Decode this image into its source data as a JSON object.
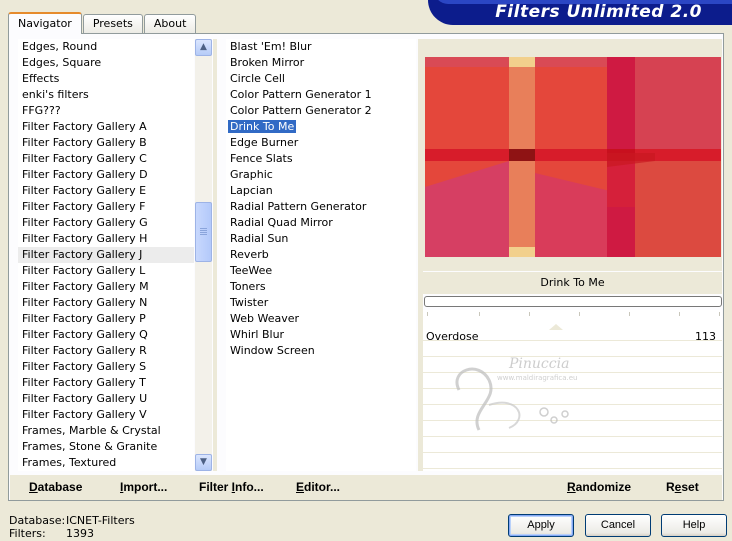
{
  "tabs": [
    "Navigator",
    "Presets",
    "About"
  ],
  "banner_title": "Filters Unlimited 2.0",
  "categories": [
    "Edges, Round",
    "Edges, Square",
    "Effects",
    "enki's filters",
    "FFG???",
    "Filter Factory Gallery A",
    "Filter Factory Gallery B",
    "Filter Factory Gallery C",
    "Filter Factory Gallery D",
    "Filter Factory Gallery E",
    "Filter Factory Gallery F",
    "Filter Factory Gallery G",
    "Filter Factory Gallery H",
    "Filter Factory Gallery J",
    "Filter Factory Gallery L",
    "Filter Factory Gallery M",
    "Filter Factory Gallery N",
    "Filter Factory Gallery P",
    "Filter Factory Gallery Q",
    "Filter Factory Gallery R",
    "Filter Factory Gallery S",
    "Filter Factory Gallery T",
    "Filter Factory Gallery U",
    "Filter Factory Gallery V",
    "Frames, Marble & Crystal",
    "Frames, Stone & Granite",
    "Frames, Textured"
  ],
  "selected_category": "Filter Factory Gallery J",
  "filters": [
    "Blast 'Em! Blur",
    "Broken Mirror",
    "Circle Cell",
    "Color Pattern Generator 1",
    "Color Pattern Generator 2",
    "Drink To Me",
    "Edge Burner",
    "Fence Slats",
    "Graphic",
    "Lapcian",
    "Radial Pattern Generator",
    "Radial Quad Mirror",
    "Radial Sun",
    "Reverb",
    "TeeWee",
    "Toners",
    "Twister",
    "Web Weaver",
    "Whirl Blur",
    "Window Screen"
  ],
  "selected_filter": "Drink To Me",
  "preview_filter_name": "Drink To Me",
  "parameter": {
    "label": "Overdose",
    "value": "113"
  },
  "watermark": {
    "text": "Pinuccia",
    "sub": "www.maldiragrafica.eu"
  },
  "bottom_links": {
    "database": {
      "ul": "D",
      "rest": "atabase"
    },
    "import": {
      "ul": "I",
      "rest": "mport..."
    },
    "filter_info": {
      "pre": "Filter ",
      "ul": "I",
      "rest": "nfo..."
    },
    "editor": {
      "ul": "E",
      "rest": "ditor..."
    },
    "randomize": {
      "ul": "R",
      "rest": "andomize"
    },
    "reset": {
      "pre": "R",
      "ul": "e",
      "rest": "set"
    }
  },
  "status": {
    "database_label": "Database:",
    "database_value": "ICNET-Filters",
    "filters_label": "Filters:",
    "filters_value": "1393"
  },
  "buttons": {
    "apply": "Apply",
    "cancel": "Cancel",
    "help": "Help"
  },
  "colors": {
    "banner": "#0c1c8c",
    "selection": "#316ac5",
    "preview_base": "#e34a3c"
  },
  "icons": {
    "scroll_up": "▲",
    "scroll_down": "▼"
  }
}
